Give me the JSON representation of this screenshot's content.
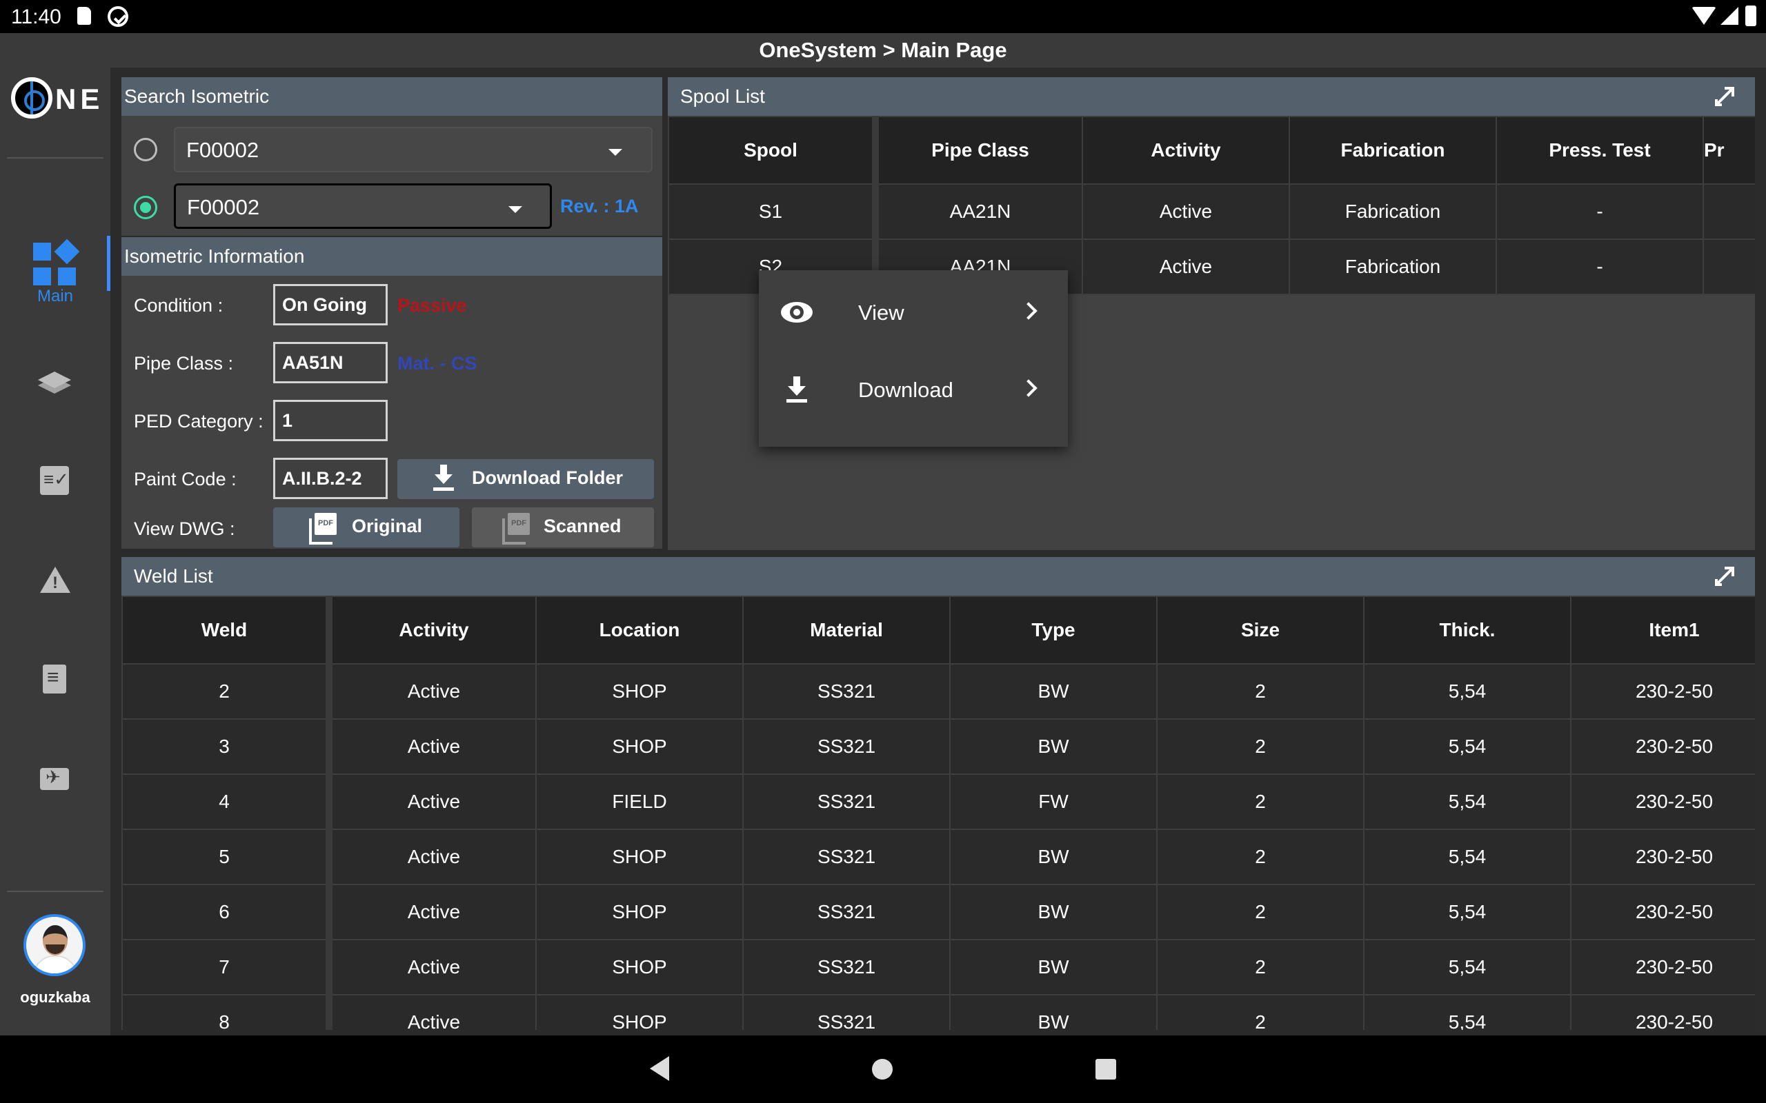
{
  "status_bar": {
    "time": "11:40"
  },
  "title": "OneSystem > Main Page",
  "sidebar": {
    "logo_text": "NE",
    "main_label": "Main",
    "username": "oguzkaba"
  },
  "search": {
    "header": "Search Isometric",
    "select1_value": "F00002",
    "select2_value": "F00002",
    "rev_label": "Rev. : 1A"
  },
  "iso_info": {
    "header": "Isometric Information",
    "condition_label": "Condition :",
    "condition_value": "On Going",
    "condition_status": "Passive",
    "pipe_class_label": "Pipe Class :",
    "pipe_class_value": "AA51N",
    "material_label": "Mat. - CS",
    "ped_label": "PED Category :",
    "ped_value": "1",
    "paint_label": "Paint Code :",
    "paint_value": "A.II.B.2-2",
    "download_folder_label": "Download Folder",
    "view_dwg_label": "View DWG :",
    "original_label": "Original",
    "scanned_label": "Scanned"
  },
  "spool": {
    "header": "Spool List",
    "columns": [
      "Spool",
      "Pipe Class",
      "Activity",
      "Fabrication",
      "Press. Test",
      "Pr"
    ],
    "rows": [
      [
        "S1",
        "AA21N",
        "Active",
        "Fabrication",
        "-",
        ""
      ],
      [
        "S2",
        "AA21N",
        "Active",
        "Fabrication",
        "-",
        ""
      ]
    ]
  },
  "context_menu": {
    "view_label": "View",
    "download_label": "Download"
  },
  "weld": {
    "header": "Weld List",
    "columns": [
      "Weld",
      "Activity",
      "Location",
      "Material",
      "Type",
      "Size",
      "Thick.",
      "Item1"
    ],
    "rows": [
      [
        "2",
        "Active",
        "SHOP",
        "SS321",
        "BW",
        "2",
        "5,54",
        "230-2-50"
      ],
      [
        "3",
        "Active",
        "SHOP",
        "SS321",
        "BW",
        "2",
        "5,54",
        "230-2-50"
      ],
      [
        "4",
        "Active",
        "FIELD",
        "SS321",
        "FW",
        "2",
        "5,54",
        "230-2-50"
      ],
      [
        "5",
        "Active",
        "SHOP",
        "SS321",
        "BW",
        "2",
        "5,54",
        "230-2-50"
      ],
      [
        "6",
        "Active",
        "SHOP",
        "SS321",
        "BW",
        "2",
        "5,54",
        "230-2-50"
      ],
      [
        "7",
        "Active",
        "SHOP",
        "SS321",
        "BW",
        "2",
        "5,54",
        "230-2-50"
      ],
      [
        "8",
        "Active",
        "SHOP",
        "SS321",
        "BW",
        "2",
        "5,54",
        "230-2-50"
      ]
    ]
  },
  "colors": {
    "accent": "#2f88f0",
    "panel_header": "#54606b",
    "radio_selected": "#3ddca6",
    "passive": "#b8151b",
    "material": "#3346b8"
  }
}
